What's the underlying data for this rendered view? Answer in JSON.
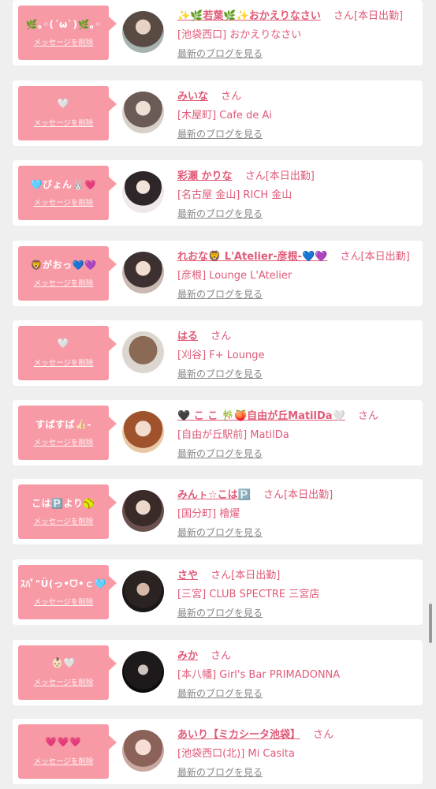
{
  "items": [
    {
      "message": "🌿｡◦(´ω`)🌿｡◦",
      "delete_label": "メッセージを削除",
      "name": "✨🌿若葉🌿✨おかえりなさい",
      "san": "さん",
      "badge": "[本日出勤]",
      "shop": "[池袋西口] おかえりなさい",
      "blog_link": "最新のブログを見る"
    },
    {
      "message": "🤍",
      "delete_label": "メッセージを削除",
      "name": "みいな",
      "san": "さん",
      "badge": "",
      "shop": "[木屋町] Cafe de Ai",
      "blog_link": "最新のブログを見る"
    },
    {
      "message": "🩵ぴょん🐰💗",
      "delete_label": "メッセージを削除",
      "name": "彩瀬 かりな",
      "san": "さん",
      "badge": "[本日出勤]",
      "shop": "[名古屋 金山] RICH 金山",
      "blog_link": "最新のブログを見る"
    },
    {
      "message": "🦁がおっ💙💜",
      "delete_label": "メッセージを削除",
      "name": "れおな🦁 L'Atelier-彦根-💙💜",
      "san": "さん",
      "badge": "[本日出勤]",
      "shop": "[彦根] Lounge L'Atelier",
      "blog_link": "最新のブログを見る"
    },
    {
      "message": "🤍",
      "delete_label": "メッセージを削除",
      "name": "はる",
      "san": "さん",
      "badge": "",
      "shop": "[刈谷] F+ Lounge",
      "blog_link": "最新のブログを見る"
    },
    {
      "message": "すぱすぱ👍🏻-",
      "delete_label": "メッセージを削除",
      "name": "🖤 こ こ 🎋🍑自由が丘MatilDa🤍",
      "san": "さん",
      "badge": "",
      "shop": "[自由が丘駅前] MatilDa",
      "blog_link": "最新のブログを見る"
    },
    {
      "message": "こは🅿️より🥎",
      "delete_label": "メッセージを削除",
      "name": "みんㇳ☆こは🅿️",
      "san": "さん",
      "badge": "[本日出勤]",
      "shop": "[国分町] 檜燿",
      "blog_link": "最新のブログを見る"
    },
    {
      "message": "ｽﾊﾟ\"Ü(っ•ᗜ•ｃ🩵",
      "delete_label": "メッセージを削除",
      "name": "さや",
      "san": "さん",
      "badge": "[本日出勤]",
      "shop": "[三宮] CLUB SPECTRE 三宮店",
      "blog_link": "最新のブログを見る"
    },
    {
      "message": "👶🏻🤍",
      "delete_label": "メッセージを削除",
      "name": "みか",
      "san": "さん",
      "badge": "",
      "shop": "[本八幡] Girl's Bar PRIMADONNA",
      "blog_link": "最新のブログを見る"
    },
    {
      "message": "💗💗💗",
      "delete_label": "メッセージを削除",
      "name": "あいり【ミカシータ池袋】",
      "san": "さん",
      "badge": "",
      "shop": "[池袋西口(北)] Mi Casita",
      "blog_link": "最新のブログを見る"
    }
  ],
  "colors": {
    "accent": "#e05a77",
    "bubble": "#f89aa6",
    "background": "#efefef"
  },
  "avatars": [
    "profile-photo-icon"
  ]
}
